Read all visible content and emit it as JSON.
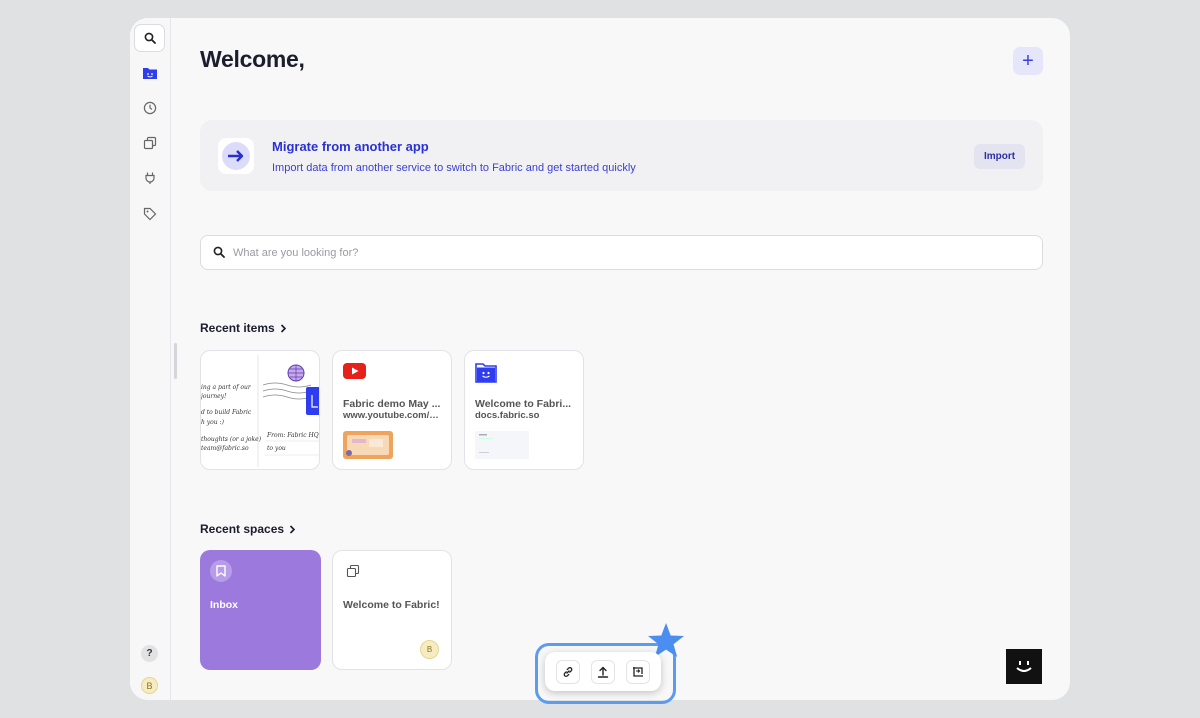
{
  "header": {
    "title": "Welcome,",
    "add_label": "+"
  },
  "migrate": {
    "title": "Migrate from another app",
    "subtitle": "Import data from another service to switch to Fabric and get started quickly",
    "button": "Import"
  },
  "search": {
    "placeholder": "What are you looking for?"
  },
  "recent_items": {
    "heading": "Recent items",
    "note_lines": [
      "ing a part of our",
      "journey!",
      "d to build Fabric",
      "h you :)",
      "thoughts (or a joke)",
      "team@fabric.so",
      "From: Fabric HQ",
      "to you"
    ],
    "cards": [
      {
        "title": "Fabric demo May ...",
        "subtitle": "www.youtube.com/w..."
      },
      {
        "title": "Welcome to Fabri...",
        "subtitle": "docs.fabric.so"
      }
    ]
  },
  "recent_spaces": {
    "heading": "Recent spaces",
    "spaces": [
      {
        "label": "Inbox"
      },
      {
        "label": "Welcome to Fabric!",
        "avatar": "B"
      }
    ]
  },
  "sidebar": {
    "help": "?",
    "avatar": "B"
  },
  "colors": {
    "accent": "#2a31d4",
    "inbox": "#9c79dc",
    "highlight": "#5b9cf0"
  }
}
